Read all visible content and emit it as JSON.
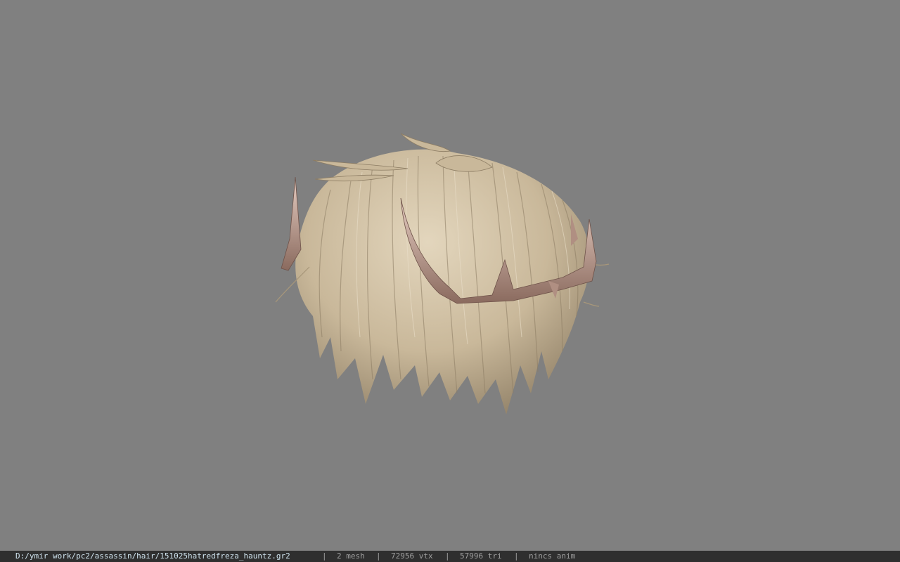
{
  "viewer": {
    "background_color": "#808080",
    "model_icon": "hair-model-icon",
    "colors": {
      "hair": "#c9b89a",
      "hair_shadow": "#8c7c63",
      "hair_highlight": "#e3d6bd",
      "crown": "#c9a79a",
      "crown_shadow": "#8a6a5e"
    }
  },
  "status": {
    "file_path": "D:/ymir work/pc2/assassin/hair/151025hatredfreza_hauntz.gr2",
    "separator": "|",
    "mesh_count": "2 mesh",
    "vertex_count": "72956 vtx",
    "triangle_count": "57996 tri",
    "animation": "nincs anim"
  }
}
